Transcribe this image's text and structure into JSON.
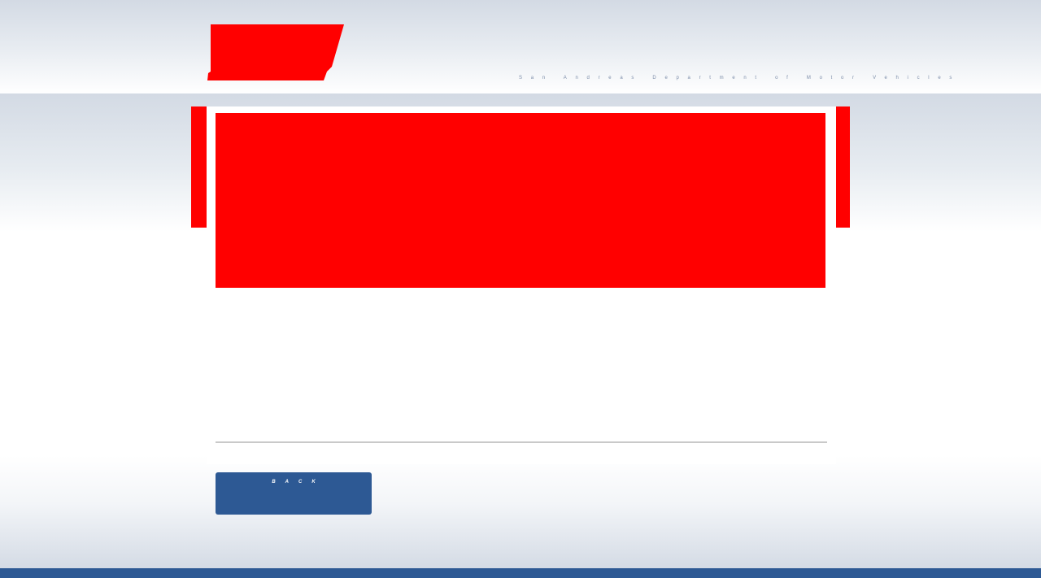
{
  "header": {
    "tagline": "San Andreas Department of Motor Vehicles"
  },
  "actions": {
    "back_label": "BACK"
  },
  "colors": {
    "accent_red": "#ff0000",
    "brand_blue": "#2d5994",
    "divider_gray": "#c9c9c9",
    "tagline_blue": "#7a8ba8"
  }
}
